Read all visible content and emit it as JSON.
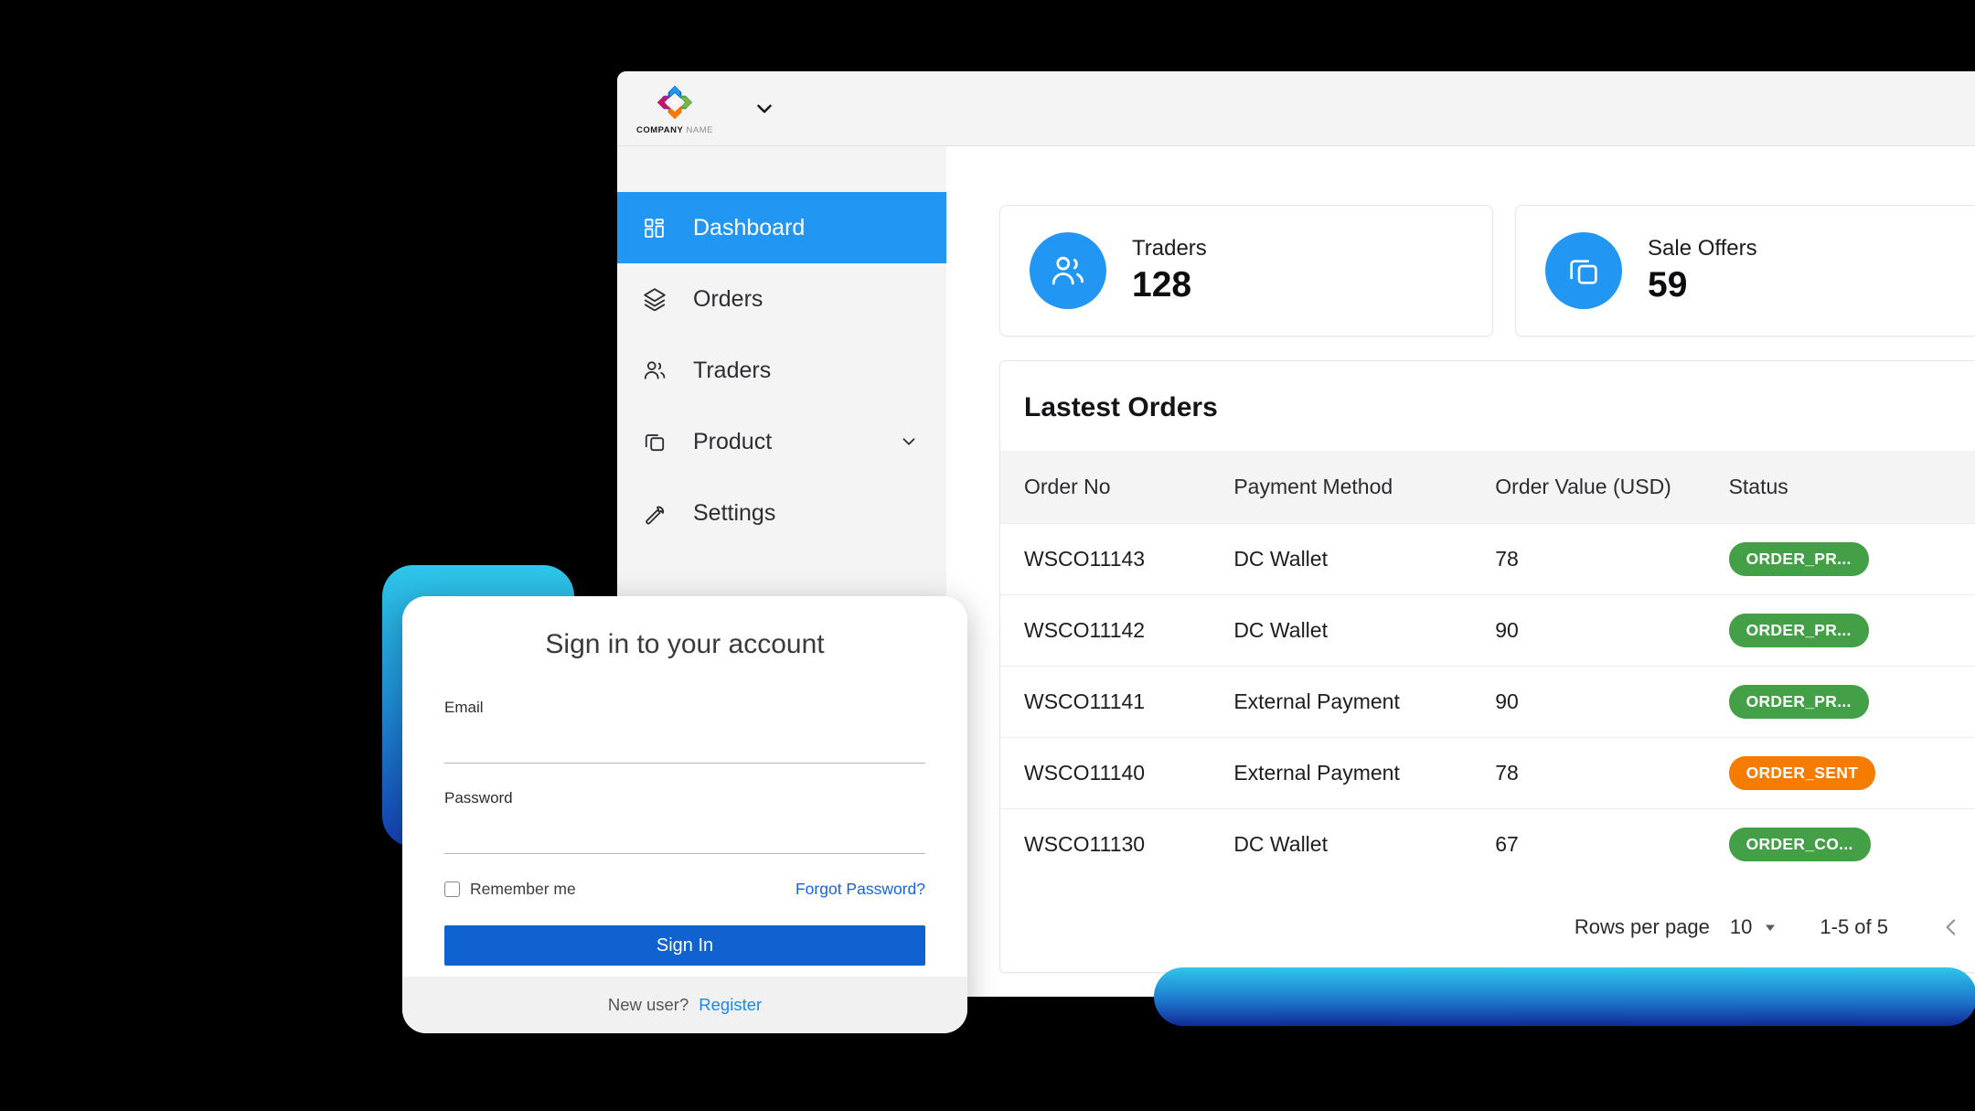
{
  "brand": {
    "name_bold": "COMPANY",
    "name_light": " NAME",
    "logo_icon": "four-petal-cross-logo"
  },
  "topbar": {
    "caret_icon": "chevron-down-icon"
  },
  "sidebar": {
    "items": [
      {
        "label": "Dashboard",
        "icon": "grid-dashboard-icon",
        "active": true,
        "caret": false
      },
      {
        "label": "Orders",
        "icon": "layers-icon",
        "active": false,
        "caret": false
      },
      {
        "label": "Traders",
        "icon": "users-icon",
        "active": false,
        "caret": false
      },
      {
        "label": "Product",
        "icon": "copy-stack-icon",
        "active": false,
        "caret": true
      },
      {
        "label": "Settings",
        "icon": "wrench-icon",
        "active": false,
        "caret": false
      }
    ]
  },
  "stats": [
    {
      "label": "Traders",
      "value": "128",
      "icon": "users-icon"
    },
    {
      "label": "Sale Offers",
      "value": "59",
      "icon": "copy-stack-icon"
    }
  ],
  "orders": {
    "title": "Lastest Orders",
    "columns": [
      "Order No",
      "Payment Method",
      "Order Value (USD)",
      "Status"
    ],
    "rows": [
      {
        "order_no": "WSCO11143",
        "payment_method": "DC Wallet",
        "order_value": "78",
        "status": "ORDER_PR...",
        "status_color": "green"
      },
      {
        "order_no": "WSCO11142",
        "payment_method": "DC Wallet",
        "order_value": "90",
        "status": "ORDER_PR...",
        "status_color": "green"
      },
      {
        "order_no": "WSCO11141",
        "payment_method": "External Payment",
        "order_value": "90",
        "status": "ORDER_PR...",
        "status_color": "green"
      },
      {
        "order_no": "WSCO11140",
        "payment_method": "External Payment",
        "order_value": "78",
        "status": "ORDER_SENT",
        "status_color": "orange"
      },
      {
        "order_no": "WSCO11130",
        "payment_method": "DC Wallet",
        "order_value": "67",
        "status": "ORDER_CO...",
        "status_color": "green"
      }
    ],
    "pagination": {
      "rows_per_page_label": "Rows per page",
      "rows_per_page_value": "10",
      "rows_per_page_caret_icon": "caret-down-icon",
      "range": "1-5 of 5",
      "prev_icon": "chevron-left-icon",
      "next_icon": "chevron-right-icon"
    }
  },
  "login": {
    "title": "Sign in to your account",
    "email_label": "Email",
    "email_value": "",
    "email_placeholder": "",
    "password_label": "Password",
    "password_value": "",
    "password_placeholder": "",
    "remember_label": "Remember me",
    "forgot_label": "Forgot Password?",
    "submit_label": "Sign In",
    "footer_prompt": "New user?",
    "footer_link": "Register"
  },
  "colors": {
    "accent_blue": "#2196f3",
    "button_blue": "#0f62d0",
    "link_blue": "#1565d8",
    "status_green": "#43a047",
    "status_orange": "#f57c00",
    "gradient_start": "#2ec6e8",
    "gradient_end": "#102a96",
    "background": "#000000"
  }
}
